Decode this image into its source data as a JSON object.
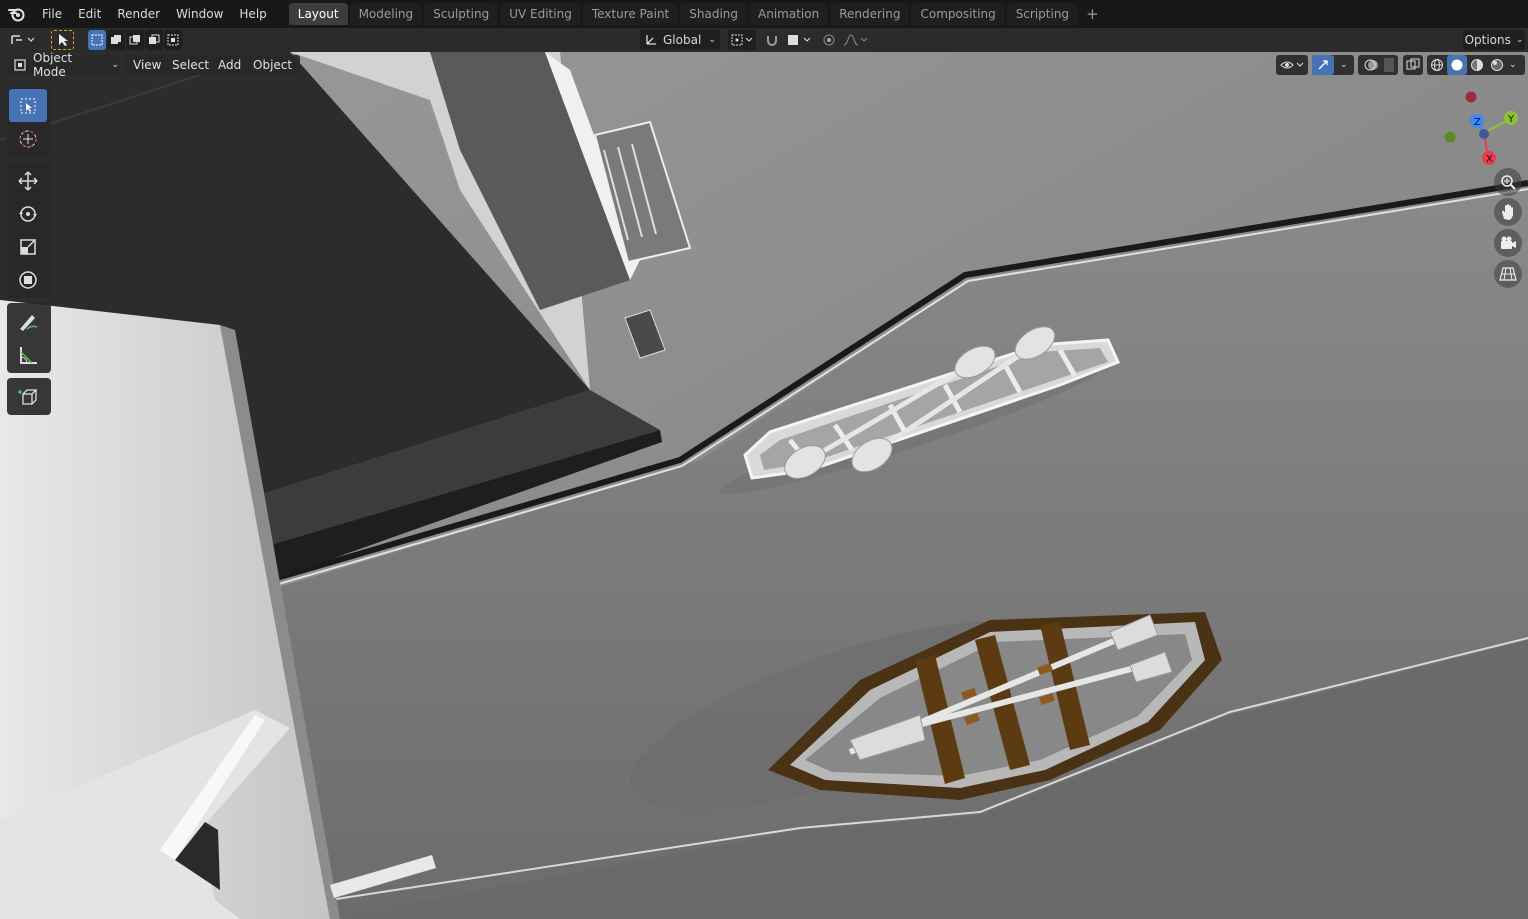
{
  "menu": {
    "items": [
      "File",
      "Edit",
      "Render",
      "Window",
      "Help"
    ]
  },
  "workspaces": {
    "tabs": [
      "Layout",
      "Modeling",
      "Sculpting",
      "UV Editing",
      "Texture Paint",
      "Shading",
      "Animation",
      "Rendering",
      "Compositing",
      "Scripting"
    ],
    "active": "Layout",
    "add_label": "+"
  },
  "tool_header": {
    "orientation": "Global",
    "options": "Options"
  },
  "viewport_header": {
    "mode": "Object Mode",
    "menus": [
      "View",
      "Select",
      "Add",
      "Object"
    ]
  },
  "toolbar": {
    "tools": [
      "select-box-icon",
      "cursor-icon",
      "move-icon",
      "rotate-icon",
      "scale-icon",
      "transform-icon",
      "annotate-icon",
      "measure-icon",
      "add-cube-icon"
    ],
    "active": "select-box-icon"
  },
  "gizmo": {
    "axes": [
      "X",
      "Y",
      "Z"
    ],
    "colors": {
      "x": "#e83c50",
      "y": "#8bc332",
      "z": "#3d8af7",
      "neg_x": "#9c2b3b",
      "neg_y": "#5e8a26"
    }
  },
  "colors": {
    "accent": "#4772b3",
    "topbar": "#181818",
    "header": "#2b2b2b"
  }
}
